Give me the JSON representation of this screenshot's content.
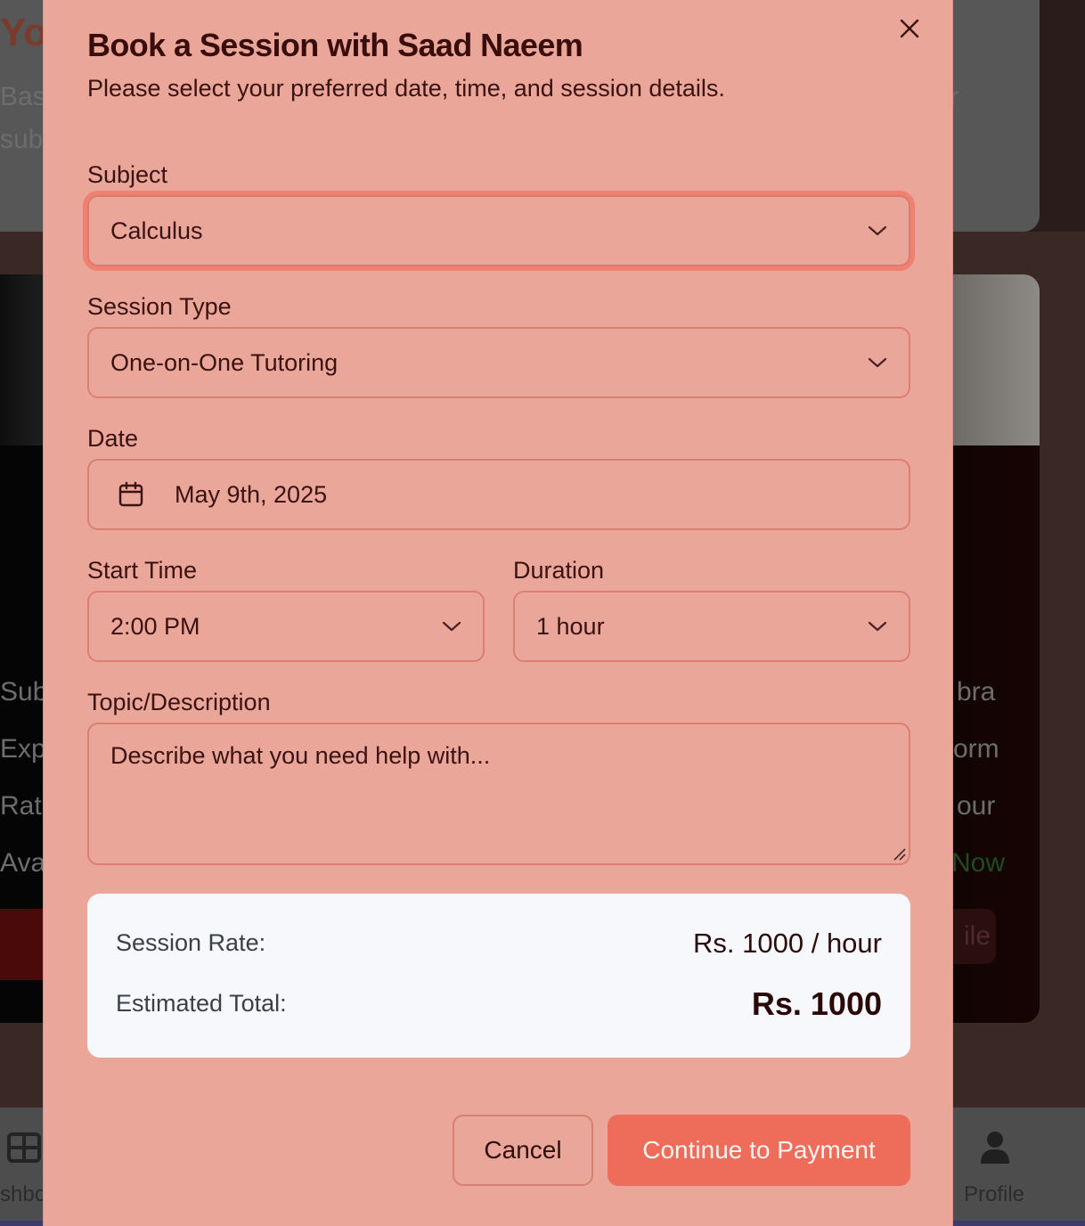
{
  "background": {
    "title_fragment": "Yo",
    "line1_left": "Bas",
    "line1_right": "r",
    "line2_left": "sub",
    "rows": [
      {
        "left": "Sub",
        "right": "bra"
      },
      {
        "left": "Exp",
        "right": "orm"
      },
      {
        "left": "Rat",
        "right": "our"
      },
      {
        "left": "Ava",
        "right": "Now"
      }
    ],
    "button_right_fragment": "ile",
    "nav": {
      "left_label": "shbo",
      "profile_label": "Profile"
    }
  },
  "modal": {
    "title": "Book a Session with Saad Naeem",
    "subtitle": "Please select your preferred date, time, and session details.",
    "close_icon": "close-icon",
    "fields": {
      "subject": {
        "label": "Subject",
        "value": "Calculus"
      },
      "session_type": {
        "label": "Session Type",
        "value": "One-on-One Tutoring"
      },
      "date": {
        "label": "Date",
        "value": "May 9th, 2025",
        "icon": "calendar-icon"
      },
      "start_time": {
        "label": "Start Time",
        "value": "2:00 PM"
      },
      "duration": {
        "label": "Duration",
        "value": "1 hour"
      },
      "topic": {
        "label": "Topic/Description",
        "placeholder": "Describe what you need help with..."
      }
    },
    "summary": {
      "rate_label": "Session Rate:",
      "rate_value": "Rs. 1000 / hour",
      "total_label": "Estimated Total:",
      "total_value": "Rs. 1000"
    },
    "buttons": {
      "cancel": "Cancel",
      "continue": "Continue to Payment"
    }
  },
  "colors": {
    "modal_bg": "#eaa698",
    "accent": "#ee6d5a",
    "focus_ring": "#f08070",
    "title_text": "#3a0d0d",
    "available_green": "#1f4a22"
  }
}
